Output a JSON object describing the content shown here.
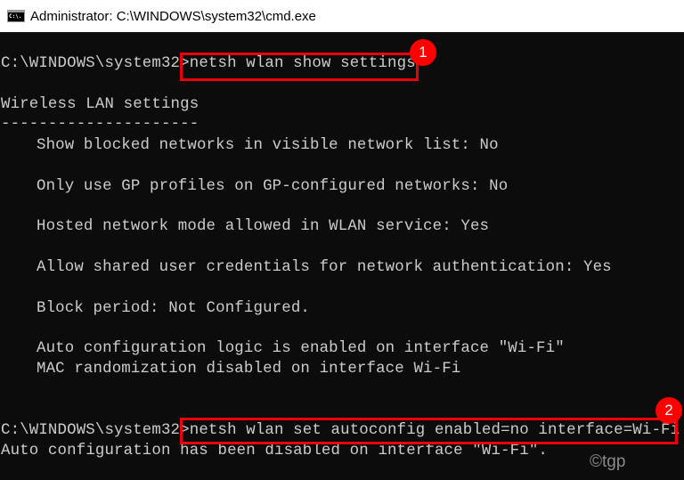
{
  "window": {
    "title": "Administrator: C:\\WINDOWS\\system32\\cmd.exe",
    "icon": "cmd-icon",
    "icon_label": "C:\\."
  },
  "console": {
    "prompt1": "C:\\WINDOWS\\system32>",
    "command1": "netsh wlan show settings",
    "heading": "Wireless LAN settings",
    "separator": "---------------------",
    "settings": [
      "Show blocked networks in visible network list: No",
      "Only use GP profiles on GP-configured networks: No",
      "Hosted network mode allowed in WLAN service: Yes",
      "Allow shared user credentials for network authentication: Yes",
      "Block period: Not Configured.",
      "Auto configuration logic is enabled on interface \"Wi-Fi\"",
      "MAC randomization disabled on interface Wi-Fi"
    ],
    "prompt2": "C:\\WINDOWS\\system32>",
    "command2": "netsh wlan set autoconfig enabled=no interface=Wi-Fi",
    "result": "Auto configuration has been disabled on interface \"Wi-Fi\"."
  },
  "annotations": {
    "badge1": "1",
    "badge2": "2",
    "highlight_color": "#e8000d",
    "badge_color": "#ff0000"
  },
  "watermark": "©tgp"
}
